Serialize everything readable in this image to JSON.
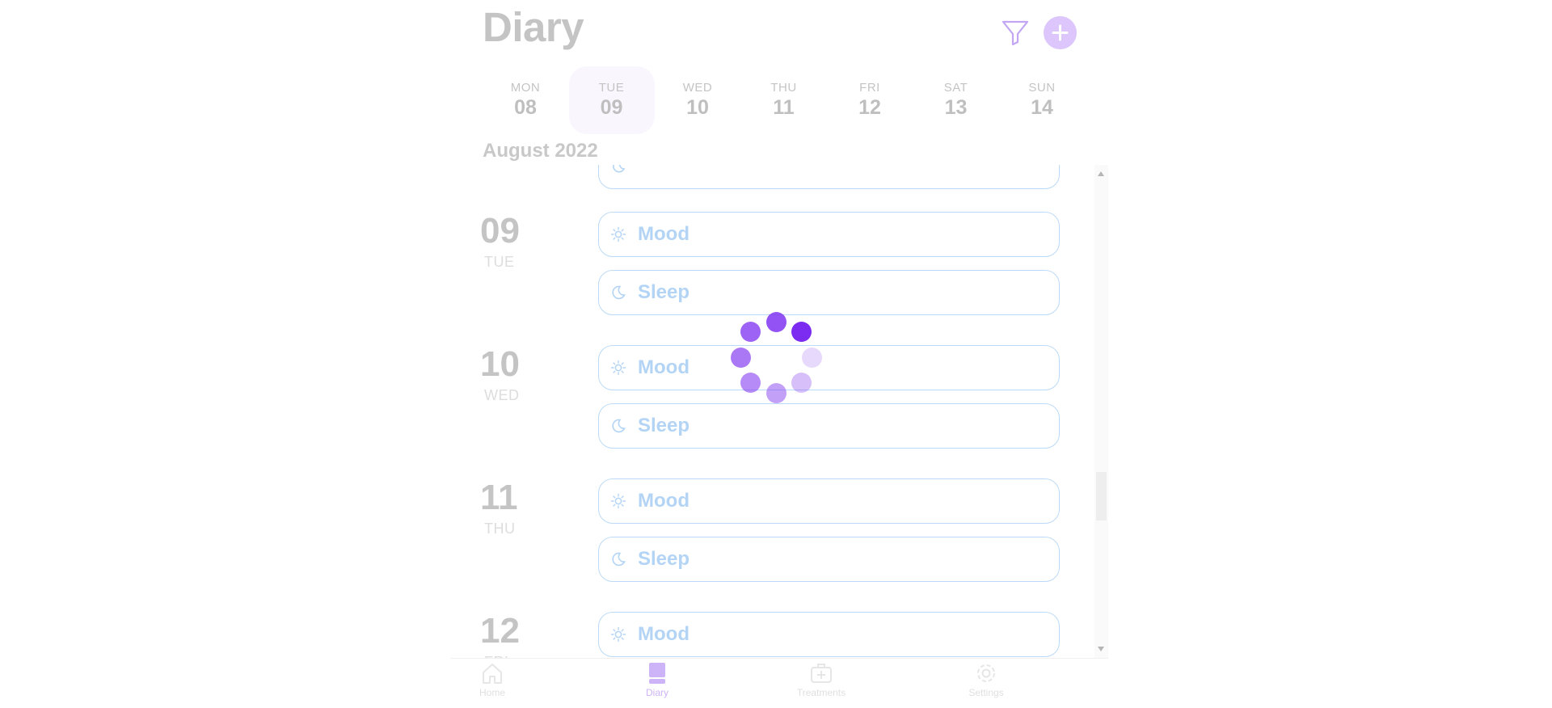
{
  "header": {
    "title": "Diary",
    "filter_icon": "filter-icon",
    "add_icon": "plus-icon"
  },
  "week": [
    {
      "dow": "MON",
      "dom": "08",
      "selected": false
    },
    {
      "dow": "TUE",
      "dom": "09",
      "selected": true
    },
    {
      "dow": "WED",
      "dom": "10",
      "selected": false
    },
    {
      "dow": "THU",
      "dom": "11",
      "selected": false
    },
    {
      "dow": "FRI",
      "dom": "12",
      "selected": false
    },
    {
      "dow": "SAT",
      "dom": "13",
      "selected": false
    },
    {
      "dow": "SUN",
      "dom": "14",
      "selected": false
    }
  ],
  "month_label": "August 2022",
  "days": [
    {
      "num": "09",
      "dow": "TUE",
      "entries": [
        {
          "label": "Mood",
          "icon": "sun-icon"
        },
        {
          "label": "Sleep",
          "icon": "moon-icon"
        }
      ]
    },
    {
      "num": "10",
      "dow": "WED",
      "entries": [
        {
          "label": "Mood",
          "icon": "sun-icon"
        },
        {
          "label": "Sleep",
          "icon": "moon-icon"
        }
      ]
    },
    {
      "num": "11",
      "dow": "THU",
      "entries": [
        {
          "label": "Mood",
          "icon": "sun-icon"
        },
        {
          "label": "Sleep",
          "icon": "moon-icon"
        }
      ]
    },
    {
      "num": "12",
      "dow": "FRI",
      "entries": [
        {
          "label": "Mood",
          "icon": "sun-icon"
        }
      ]
    }
  ],
  "bottom_nav": [
    {
      "label": "Home",
      "icon": "home-icon",
      "active": false
    },
    {
      "label": "Diary",
      "icon": "book-icon",
      "active": true
    },
    {
      "label": "Treatments",
      "icon": "medical-kit-icon",
      "active": false
    },
    {
      "label": "Settings",
      "icon": "gear-icon",
      "active": false
    }
  ],
  "colors": {
    "accent": "#7b2cf0",
    "entry_border": "#bcdaf7",
    "entry_text": "#b3d4f5",
    "selected_day_bg": "#faf6fe"
  },
  "loading": true
}
